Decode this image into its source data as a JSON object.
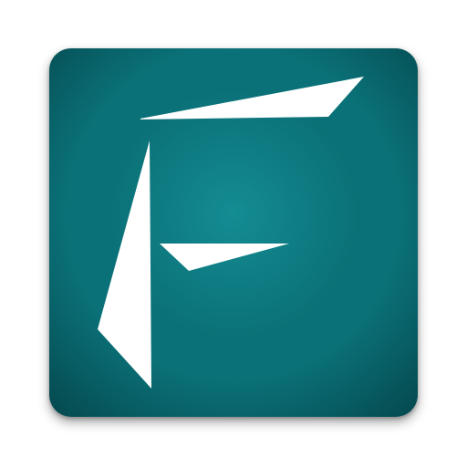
{
  "app_icon": {
    "glyph_letter": "F",
    "glyph_icon": "stylized-letter-f-icon",
    "colors": {
      "background_center": "#138c92",
      "background_mid": "#0b7178",
      "background_edge": "#04484e",
      "glyph": "#ffffff"
    }
  }
}
